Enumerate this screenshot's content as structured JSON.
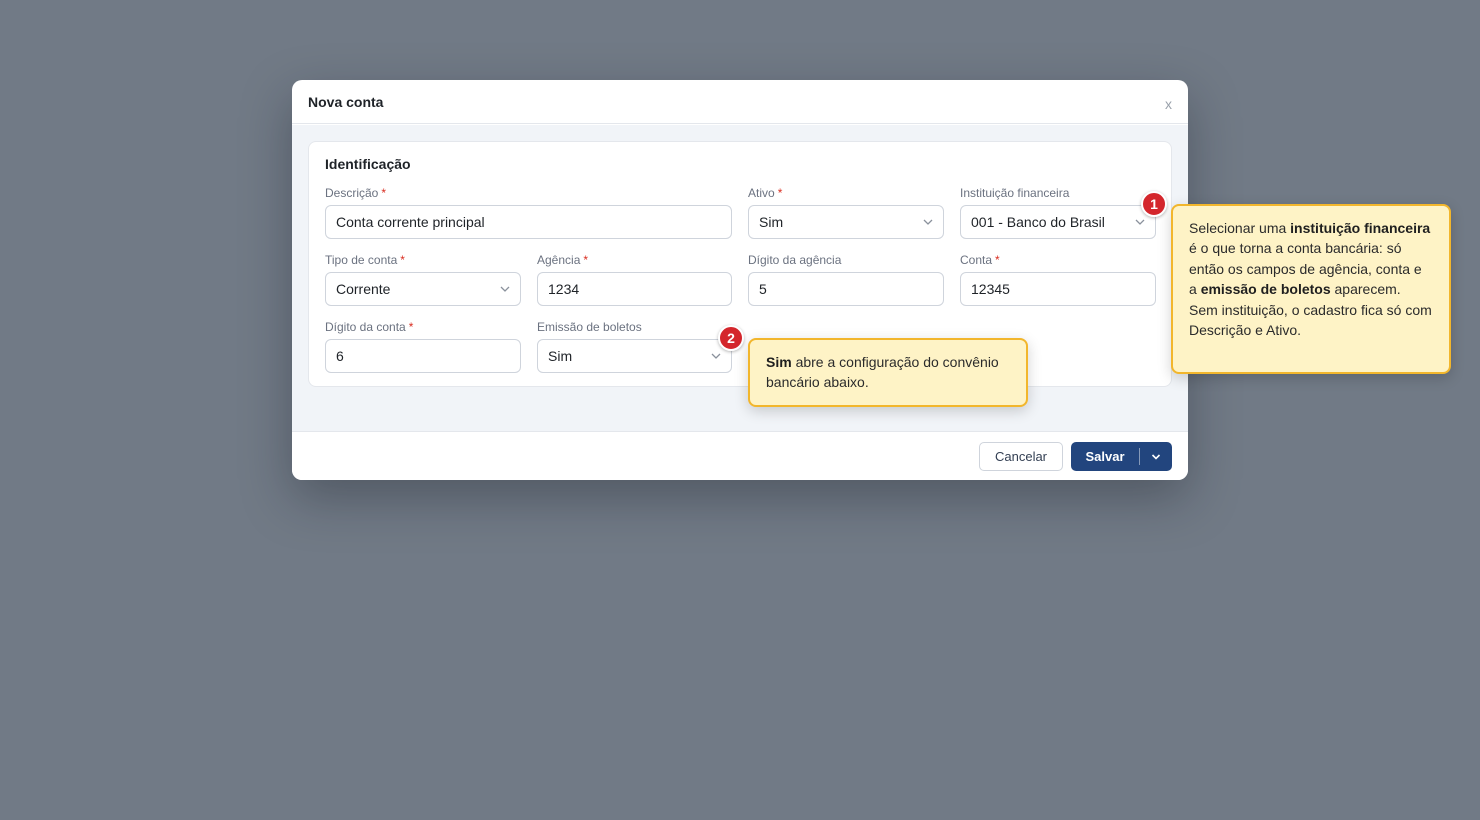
{
  "modal": {
    "title": "Nova conta",
    "close_label": "x"
  },
  "section": {
    "title": "Identificação"
  },
  "fields": {
    "descricao": {
      "label": "Descrição",
      "required_mark": "*",
      "value": "Conta corrente principal"
    },
    "ativo": {
      "label": "Ativo",
      "required_mark": "*",
      "value": "Sim"
    },
    "instituicao": {
      "label": "Instituição financeira",
      "value": "001 - Banco do Brasil"
    },
    "tipo_conta": {
      "label": "Tipo de conta",
      "required_mark": "*",
      "value": "Corrente"
    },
    "agencia": {
      "label": "Agência",
      "required_mark": "*",
      "value": "1234"
    },
    "digito_agencia": {
      "label": "Dígito da agência",
      "value": "5"
    },
    "conta": {
      "label": "Conta",
      "required_mark": "*",
      "value": "12345"
    },
    "digito_conta": {
      "label": "Dígito da conta",
      "required_mark": "*",
      "value": "6"
    },
    "emissao_boletos": {
      "label": "Emissão de boletos",
      "value": "Sim"
    }
  },
  "footer": {
    "cancel_label": "Cancelar",
    "save_label": "Salvar"
  },
  "annotations": [
    {
      "number": "1",
      "parts": [
        {
          "text": "Selecionar uma ",
          "bold": false
        },
        {
          "text": "instituição financeira",
          "bold": true
        },
        {
          "text": " é o que torna a conta bancária: só então os campos de agência, conta e a ",
          "bold": false
        },
        {
          "text": "emissão de boletos",
          "bold": true
        },
        {
          "text": " aparecem. Sem instituição, o cadastro fica só com Descrição e Ativo.",
          "bold": false
        }
      ]
    },
    {
      "number": "2",
      "parts": [
        {
          "text": "Sim",
          "bold": true
        },
        {
          "text": " abre a configuração do convênio bancário abaixo.",
          "bold": false
        }
      ]
    }
  ],
  "colors": {
    "backdrop": "#717a86",
    "primary": "#22457e",
    "required": "#d92d20",
    "badge": "#d4262c",
    "tip_bg": "#fef3c6",
    "tip_border": "#f2b62c"
  }
}
